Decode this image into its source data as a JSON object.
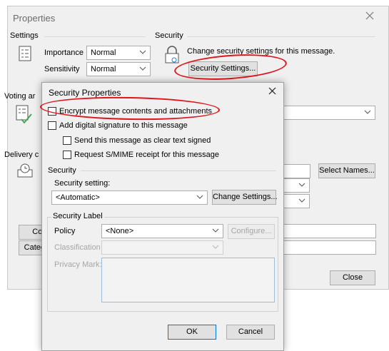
{
  "window": {
    "title": "Properties"
  },
  "settings": {
    "header": "Settings",
    "importance_label": "Importance",
    "importance_value": "Normal",
    "sensitivity_label": "Sensitivity",
    "sensitivity_value": "Normal"
  },
  "security_group": {
    "header": "Security",
    "description": "Change security settings for this message.",
    "button": "Security Settings..."
  },
  "voting": {
    "header_partial": "Voting ar"
  },
  "delivery": {
    "header_partial": "Delivery c"
  },
  "right_side": {
    "select_names": "Select Names...",
    "close": "Close"
  },
  "left_partial": {
    "contacts": "Cor",
    "categories": "Categ"
  },
  "dialog": {
    "title": "Security Properties",
    "encrypt": "Encrypt message contents and attachments",
    "signature": "Add digital signature to this message",
    "clear_text": "Send this message as clear text signed",
    "smime_receipt": "Request S/MIME receipt for this message",
    "security_header": "Security",
    "security_setting_label": "Security setting:",
    "security_setting_value": "<Automatic>",
    "change_settings": "Change Settings...",
    "label_header": "Security Label",
    "policy_label": "Policy",
    "policy_value": "<None>",
    "configure": "Configure...",
    "classification_label": "Classification",
    "privacy_label": "Privacy Mark:",
    "ok": "OK",
    "cancel": "Cancel"
  }
}
